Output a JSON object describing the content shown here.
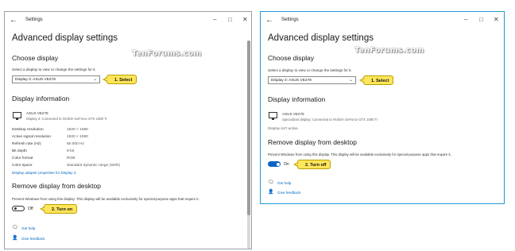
{
  "watermark": "TenForums.com",
  "left": {
    "window_title": "Settings",
    "back_glyph": "←",
    "controls": [
      "–",
      "□",
      "✕"
    ],
    "page_title": "Advanced display settings",
    "choose_display": {
      "heading": "Choose display",
      "hint": "Select a display to view or change the settings for it.",
      "selected": "Display 3: ASUS VE278"
    },
    "callout_select": "1. Select",
    "display_info": {
      "heading": "Display information",
      "monitor_name": "ASUS VE278",
      "monitor_sub": "Display 3: Connected to NVIDIA GeForce GTX 1080 Ti",
      "rows": [
        {
          "label": "Desktop resolution",
          "value": "1920 × 1080"
        },
        {
          "label": "Active signal resolution",
          "value": "1920 × 1080"
        },
        {
          "label": "Refresh rate (Hz)",
          "value": "60.000 Hz"
        },
        {
          "label": "Bit depth",
          "value": "8-bit"
        },
        {
          "label": "Color format",
          "value": "RGB"
        },
        {
          "label": "Color space",
          "value": "Standard dynamic range (SDR)"
        }
      ],
      "adapter_link": "Display adapter properties for Display 3"
    },
    "remove": {
      "heading": "Remove display from desktop",
      "desc": "Prevent Windows from using this display. This display will be available exclusively for special-purpose apps that require it.",
      "toggle_state": "Off",
      "callout": "2. Turn on"
    },
    "get_help": "Get help",
    "give_feedback": "Give feedback"
  },
  "right": {
    "window_title": "Settings",
    "back_glyph": "←",
    "controls": [
      "–",
      "□",
      "✕"
    ],
    "page_title": "Advanced display settings",
    "choose_display": {
      "heading": "Choose display",
      "hint": "Select a display to view or change the settings for it.",
      "selected": "Display 3: ASUS VE278"
    },
    "callout_select": "1. Select",
    "display_info": {
      "heading": "Display information",
      "monitor_name": "ASUS VE278",
      "monitor_sub": "Specialized display: Connected to NVIDIA GeForce GTX 1080 Ti",
      "status": "Display isn't active."
    },
    "remove": {
      "heading": "Remove display from desktop",
      "desc": "Prevent Windows from using this display. This display will be available exclusively for special-purpose apps that require it.",
      "toggle_state": "On",
      "callout": "2. Turn off"
    },
    "get_help": "Get help",
    "give_feedback": "Give feedback"
  }
}
